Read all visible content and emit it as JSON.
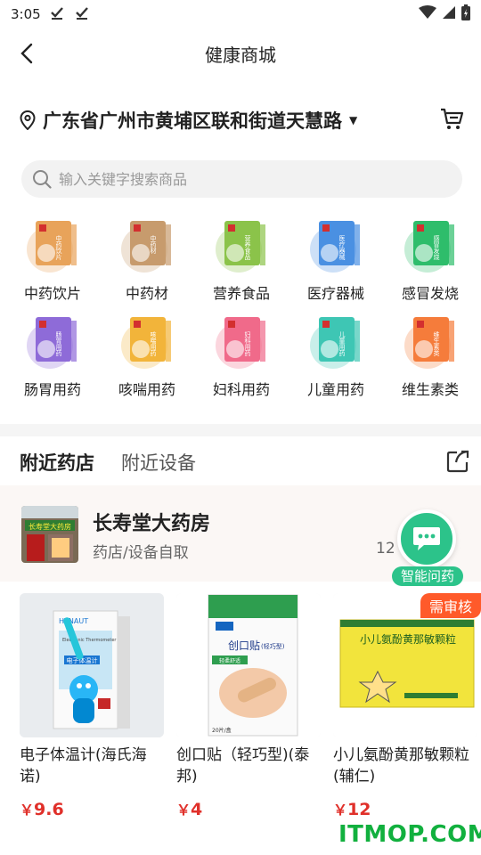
{
  "status_bar": {
    "time": "3:05"
  },
  "nav": {
    "title": "健康商城"
  },
  "location": {
    "address": "广东省广州市黄埔区联和街道天慧路"
  },
  "search": {
    "placeholder": "输入关键字搜索商品"
  },
  "categories": [
    {
      "label": "中药饮片",
      "box_text": "中药饮片",
      "color": "#e8a35a"
    },
    {
      "label": "中药材",
      "box_text": "中药材",
      "color": "#c79b6d"
    },
    {
      "label": "营养食品",
      "box_text": "营养食品",
      "color": "#8bc34a"
    },
    {
      "label": "医疗器械",
      "box_text": "医疗器械",
      "color": "#4a90e2"
    },
    {
      "label": "感冒发烧",
      "box_text": "感冒发烧",
      "color": "#2ebd6b"
    },
    {
      "label": "肠胃用药",
      "box_text": "肠胃用药",
      "color": "#8e6bd8"
    },
    {
      "label": "咳喘用药",
      "box_text": "咳喘用药",
      "color": "#f2b43a"
    },
    {
      "label": "妇科用药",
      "box_text": "妇科用药",
      "color": "#f06a8a"
    },
    {
      "label": "儿童用药",
      "box_text": "儿童用药",
      "color": "#3ec6b4"
    },
    {
      "label": "维生素类",
      "box_text": "维生素类",
      "color": "#f57c3b"
    }
  ],
  "tabs": [
    {
      "label": "附近药店",
      "active": true
    },
    {
      "label": "附近设备",
      "active": false
    }
  ],
  "store": {
    "name": "长寿堂大药房",
    "subtitle": "药店/设备自取",
    "distance": "12",
    "thumb_sign": "长寿堂大药房"
  },
  "ai_assistant": {
    "label": "智能问药"
  },
  "products": [
    {
      "name": "电子体温计(海氏海诺)",
      "currency": "￥",
      "price": "9.6",
      "badge": "",
      "pack_brand": "HYNAUT",
      "pack_text_en": "Electronic Thermometer",
      "pack_text": "电子体温计"
    },
    {
      "name": "创口贴（轻巧型)(泰邦)",
      "currency": "￥",
      "price": "4",
      "badge": "",
      "pack_text": "创口贴",
      "pack_sub": "(轻巧型)",
      "pack_tag": "轻柔舒适",
      "pack_count": "20片/盒"
    },
    {
      "name": "小儿氨酚黄那敏颗粒(辅仁)",
      "currency": "￥",
      "price": "12",
      "badge": "需审核",
      "pack_text": "小儿氨酚黄那敏颗粒"
    }
  ],
  "watermark": "ITMOP.COM"
}
